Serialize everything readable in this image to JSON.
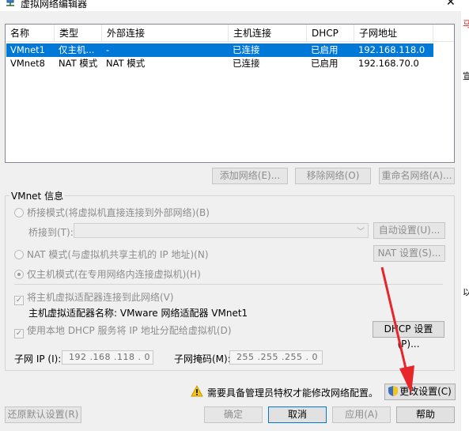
{
  "window": {
    "title": "虚拟网络编辑器",
    "close_glyph": "✕"
  },
  "table": {
    "headers": [
      "名称",
      "类型",
      "外部连接",
      "主机连接",
      "DHCP",
      "子网地址"
    ],
    "rows": [
      [
        "VMnet1",
        "仅主机...",
        "-",
        "已连接",
        "已启用",
        "192.168.118.0"
      ],
      [
        "VMnet8",
        "NAT 模式",
        "NAT 模式",
        "已连接",
        "已启用",
        "192.168.70.0"
      ]
    ],
    "selected_row": 0
  },
  "table_buttons": {
    "add": "添加网络(E)...",
    "remove": "移除网络(O)",
    "rename": "重命名网络(A)..."
  },
  "vmnet_info": {
    "group_label": "VMnet 信息",
    "bridge_option": "桥接模式(将虚拟机直接连接到外部网络)(B)",
    "bridge_to_label": "桥接到(T):",
    "bridge_to_value": "",
    "auto_button": "自动设置(U)...",
    "nat_option": "NAT 模式(与虚拟机共享主机的 IP 地址)(N)",
    "nat_settings_button": "NAT 设置(S)...",
    "hostonly_option": "仅主机模式(在专用网络内连接虚拟机)(H)",
    "connect_adapter_check": "将主机虚拟适配器连接到此网络(V)",
    "adapter_name_line": "主机虚拟适配器名称: VMware 网络适配器 VMnet1",
    "dhcp_check": "使用本地 DHCP 服务将 IP 地址分配给虚拟机(D)",
    "dhcp_settings_button": "DHCP 设置(P)...",
    "subnet_ip_label": "子网 IP (I):",
    "subnet_ip_value": "192 .168 .118 .  0",
    "subnet_mask_label": "子网掩码(M):",
    "subnet_mask_value": "255 .255 .255 .  0",
    "checked_glyph": "✓"
  },
  "admin_notice": {
    "text": "需要具备管理员特权才能修改网络配置。",
    "change_settings_button": "更改设置(C)"
  },
  "footer": {
    "restore_defaults": "还原默认设置(R)",
    "ok": "确定",
    "cancel": "取消",
    "apply": "应用(A)",
    "help": "帮助"
  },
  "background_glyphs": {
    "top": "马",
    "mid": "宣",
    "low": "以"
  },
  "colors": {
    "selection": "#0078d7",
    "disabled_text": "#8d8d8d",
    "annotation_arrow": "#e8252a",
    "warning": "#f5c518"
  }
}
